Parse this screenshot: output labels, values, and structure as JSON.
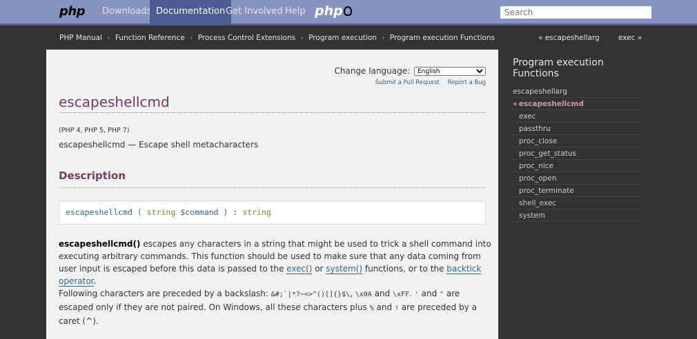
{
  "nav": {
    "logo": "php",
    "items": [
      "Downloads",
      "Documentation",
      "Get Involved",
      "Help"
    ],
    "active_index": 1,
    "logo2": "php"
  },
  "search": {
    "placeholder": "Search"
  },
  "breadcrumb": {
    "items": [
      "PHP Manual",
      "Function Reference",
      "Process Control Extensions",
      "Program execution",
      "Program execution Functions"
    ],
    "separator": "›",
    "prev": "« escapeshellarg",
    "next": "exec »"
  },
  "content": {
    "change_language_label": "Change language:",
    "language_selected": "English",
    "submit_pr": "Submit a Pull Request",
    "report_bug": "Report a Bug",
    "title": "escapeshellcmd",
    "versions": "(PHP 4, PHP 5, PHP 7)",
    "purpose": "escapeshellcmd — Escape shell metacharacters",
    "description_heading": "Description",
    "synopsis": {
      "func": "escapeshellcmd",
      "open": " ( ",
      "param_type": "string",
      "param_name": "$command",
      "close": " ) : ",
      "return_type": "string"
    },
    "para1": {
      "func": "escapeshellcmd()",
      "text1": " escapes any characters in a string that might be used to trick a shell command into executing arbitrary commands. This function should be used to make sure that any data coming from user input is escaped before this data is passed to the ",
      "link1": "exec()",
      "text2": " or ",
      "link2": "system()",
      "text3": " functions, or to the ",
      "link3": "backtick operator",
      "text4": "."
    },
    "para2": {
      "text1": "Following characters are preceded by a backslash: ",
      "chars": "&#;`|*?~<>^()[]{}$\\",
      "text2": ", ",
      "x0a": "\\x0A",
      "text3": " and ",
      "xff": "\\xFF",
      "text4": ". ",
      "q1": "'",
      "text5": " and ",
      "q2": "\"",
      "text6": " are escaped only if they are not paired. On Windows, all these characters plus ",
      "pct": "%",
      "text7": " and ",
      "bang": "!",
      "text8": " are preceded by a caret (",
      "caret": "^",
      "text9": ")."
    }
  },
  "sidebar": {
    "heading": "Program execution Functions",
    "current_marker": "»",
    "items": [
      "escapeshellarg",
      "escapeshellcmd",
      "exec",
      "passthru",
      "proc_close",
      "proc_get_status",
      "proc_nice",
      "proc_open",
      "proc_terminate",
      "shell_exec",
      "system"
    ],
    "current_index": 1
  }
}
